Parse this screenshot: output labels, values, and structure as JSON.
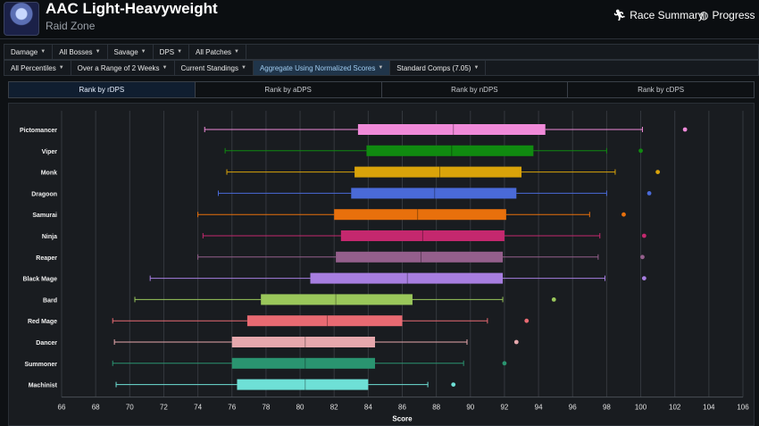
{
  "header": {
    "title": "AAC Light-Heavyweight",
    "subtitle": "Raid Zone",
    "race_summary_label": "Race Summary",
    "progress_label": "Progress"
  },
  "filters_row1": [
    {
      "label": "Damage"
    },
    {
      "label": "All Bosses"
    },
    {
      "label": "Savage"
    },
    {
      "label": "DPS"
    },
    {
      "label": "All Patches"
    }
  ],
  "filters_row2": [
    {
      "label": "All Percentiles",
      "active": false
    },
    {
      "label": "Over a Range of 2 Weeks",
      "active": false
    },
    {
      "label": "Current Standings",
      "active": false
    },
    {
      "label": "Aggregate Using Normalized Scores",
      "active": true
    },
    {
      "label": "Standard Comps (7.05)",
      "active": false
    }
  ],
  "rank_tabs": [
    {
      "label": "Rank by rDPS",
      "active": true
    },
    {
      "label": "Rank by aDPS",
      "active": false
    },
    {
      "label": "Rank by nDPS",
      "active": false
    },
    {
      "label": "Rank by cDPS",
      "active": false
    }
  ],
  "chart_data": {
    "type": "boxplot",
    "orientation": "horizontal",
    "xlabel": "Score",
    "xlim": [
      66,
      106
    ],
    "xticks": [
      66,
      68,
      70,
      72,
      74,
      76,
      78,
      80,
      82,
      84,
      86,
      88,
      90,
      92,
      94,
      96,
      98,
      100,
      102,
      104,
      106
    ],
    "grid": true,
    "series": [
      {
        "name": "Pictomancer",
        "min": 74.4,
        "q1": 83.4,
        "median": 89.0,
        "q3": 94.4,
        "max": 100.1,
        "outliers": [
          102.6
        ],
        "color": "#f08ad9"
      },
      {
        "name": "Viper",
        "min": 75.6,
        "q1": 83.9,
        "median": 88.9,
        "q3": 93.7,
        "max": 98.0,
        "outliers": [
          100.0
        ],
        "color": "#108a10"
      },
      {
        "name": "Monk",
        "min": 75.7,
        "q1": 83.2,
        "median": 88.2,
        "q3": 93.0,
        "max": 98.5,
        "outliers": [
          101.0
        ],
        "color": "#d9a30a"
      },
      {
        "name": "Dragoon",
        "min": 75.2,
        "q1": 83.0,
        "median": 87.9,
        "q3": 92.7,
        "max": 98.0,
        "outliers": [
          100.5
        ],
        "color": "#4a6ad8"
      },
      {
        "name": "Samurai",
        "min": 74.0,
        "q1": 82.0,
        "median": 86.9,
        "q3": 92.1,
        "max": 97.0,
        "outliers": [
          99.0
        ],
        "color": "#e8700c"
      },
      {
        "name": "Ninja",
        "min": 74.3,
        "q1": 82.4,
        "median": 87.2,
        "q3": 92.0,
        "max": 97.6,
        "outliers": [
          100.2
        ],
        "color": "#c4286e"
      },
      {
        "name": "Reaper",
        "min": 74.0,
        "q1": 82.1,
        "median": 87.1,
        "q3": 91.9,
        "max": 97.5,
        "outliers": [
          100.1
        ],
        "color": "#945f8c"
      },
      {
        "name": "Black Mage",
        "min": 71.2,
        "q1": 80.6,
        "median": 86.3,
        "q3": 91.9,
        "max": 97.9,
        "outliers": [
          100.2
        ],
        "color": "#a77ee0"
      },
      {
        "name": "Bard",
        "min": 70.3,
        "q1": 77.7,
        "median": 82.1,
        "q3": 86.6,
        "max": 91.9,
        "outliers": [
          94.9
        ],
        "color": "#9ac75b"
      },
      {
        "name": "Red Mage",
        "min": 69.0,
        "q1": 76.9,
        "median": 81.6,
        "q3": 86.0,
        "max": 91.0,
        "outliers": [
          93.3
        ],
        "color": "#e86a72"
      },
      {
        "name": "Dancer",
        "min": 69.1,
        "q1": 76.0,
        "median": 80.3,
        "q3": 84.4,
        "max": 89.8,
        "outliers": [
          92.7
        ],
        "color": "#e6a8ad"
      },
      {
        "name": "Summoner",
        "min": 69.0,
        "q1": 76.0,
        "median": 80.3,
        "q3": 84.4,
        "max": 89.6,
        "outliers": [
          92.0
        ],
        "color": "#2a9470"
      },
      {
        "name": "Machinist",
        "min": 69.2,
        "q1": 76.3,
        "median": 80.3,
        "q3": 84.0,
        "max": 87.5,
        "outliers": [
          89.0
        ],
        "color": "#6ee0d6"
      }
    ]
  }
}
